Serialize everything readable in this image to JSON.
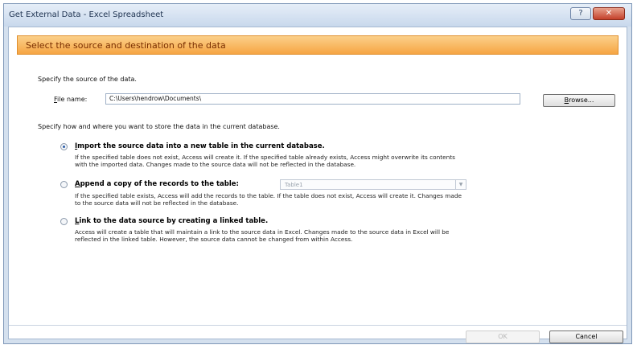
{
  "window": {
    "title": "Get External Data - Excel Spreadsheet",
    "help_button": "?",
    "close_button": "✕"
  },
  "header": {
    "title": "Select the source and destination of the data"
  },
  "source": {
    "label": "Specify the source of the data.",
    "file_name_label_ul": "F",
    "file_name_label_rest": "ile name:",
    "file_name_value": "C:\\Users\\hendrow\\Documents\\",
    "browse_ul": "B",
    "browse_rest": "rowse..."
  },
  "storage_prompt": "Specify how and where you want to store the data in the current database.",
  "options": [
    {
      "label_ul": "I",
      "label_rest": "mport the source data into a new table in the current database.",
      "desc_line1": "If the specified table does not exist, Access will create it. If the specified table already exists, Access might overwrite its contents",
      "desc_line2": "with the imported data. Changes made to the source data will not be reflected in the database.",
      "selected": true
    },
    {
      "label_ul": "A",
      "label_rest": "ppend a copy of the records to the table:",
      "combo_value": "Table1",
      "desc_line1": "If the specified table exists, Access will add the records to the table. If the table does not exist, Access will create it. Changes made",
      "desc_line2": "to the source data will not be reflected in the database.",
      "selected": false
    },
    {
      "label_ul": "L",
      "label_rest": "ink to the data source by creating a linked table.",
      "desc_line1": "Access will create a table that will maintain a link to the source data in Excel. Changes made to the source data in Excel will be",
      "desc_line2": "reflected in the linked table. However, the source data cannot be changed from within Access.",
      "selected": false
    }
  ],
  "footer": {
    "ok_label": "OK",
    "cancel_label": "Cancel"
  }
}
